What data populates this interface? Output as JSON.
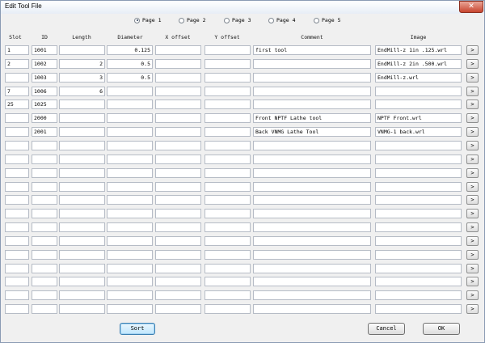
{
  "window": {
    "title": "Edit Tool File",
    "close_glyph": "✕"
  },
  "pages": [
    {
      "label": "Page 1",
      "selected": true
    },
    {
      "label": "Page 2",
      "selected": false
    },
    {
      "label": "Page 3",
      "selected": false
    },
    {
      "label": "Page 4",
      "selected": false
    },
    {
      "label": "Page 5",
      "selected": false
    }
  ],
  "columns": {
    "slot": "Slot",
    "id": "ID",
    "length": "Length",
    "diameter": "Diameter",
    "x_offset": "X offset",
    "y_offset": "Y offset",
    "comment": "Comment",
    "image": "Image"
  },
  "rows": [
    {
      "slot": "1",
      "id": "1001",
      "length": "",
      "diameter": "0.125",
      "x_offset": "",
      "y_offset": "",
      "comment": "first tool",
      "image": "EndMill-z 1in .125.wrl"
    },
    {
      "slot": "2",
      "id": "1002",
      "length": "2",
      "diameter": "0.5",
      "x_offset": "",
      "y_offset": "",
      "comment": "",
      "image": "EndMill-z 2in .500.wrl"
    },
    {
      "slot": "",
      "id": "1003",
      "length": "3",
      "diameter": "0.5",
      "x_offset": "",
      "y_offset": "",
      "comment": "",
      "image": "EndMill-z.wrl"
    },
    {
      "slot": "7",
      "id": "1006",
      "length": "6",
      "diameter": "",
      "x_offset": "",
      "y_offset": "",
      "comment": "",
      "image": ""
    },
    {
      "slot": "25",
      "id": "1025",
      "length": "",
      "diameter": "",
      "x_offset": "",
      "y_offset": "",
      "comment": "",
      "image": ""
    },
    {
      "slot": "",
      "id": "2000",
      "length": "",
      "diameter": "",
      "x_offset": "",
      "y_offset": "",
      "comment": "Front NPTF Lathe tool",
      "image": "NPTF Front.wrl"
    },
    {
      "slot": "",
      "id": "2001",
      "length": "",
      "diameter": "",
      "x_offset": "",
      "y_offset": "",
      "comment": "Back VNMG Lathe Tool",
      "image": "VNMG-1 back.wrl"
    },
    {
      "slot": "",
      "id": "",
      "length": "",
      "diameter": "",
      "x_offset": "",
      "y_offset": "",
      "comment": "",
      "image": ""
    },
    {
      "slot": "",
      "id": "",
      "length": "",
      "diameter": "",
      "x_offset": "",
      "y_offset": "",
      "comment": "",
      "image": ""
    },
    {
      "slot": "",
      "id": "",
      "length": "",
      "diameter": "",
      "x_offset": "",
      "y_offset": "",
      "comment": "",
      "image": ""
    },
    {
      "slot": "",
      "id": "",
      "length": "",
      "diameter": "",
      "x_offset": "",
      "y_offset": "",
      "comment": "",
      "image": ""
    },
    {
      "slot": "",
      "id": "",
      "length": "",
      "diameter": "",
      "x_offset": "",
      "y_offset": "",
      "comment": "",
      "image": ""
    },
    {
      "slot": "",
      "id": "",
      "length": "",
      "diameter": "",
      "x_offset": "",
      "y_offset": "",
      "comment": "",
      "image": ""
    },
    {
      "slot": "",
      "id": "",
      "length": "",
      "diameter": "",
      "x_offset": "",
      "y_offset": "",
      "comment": "",
      "image": ""
    },
    {
      "slot": "",
      "id": "",
      "length": "",
      "diameter": "",
      "x_offset": "",
      "y_offset": "",
      "comment": "",
      "image": ""
    },
    {
      "slot": "",
      "id": "",
      "length": "",
      "diameter": "",
      "x_offset": "",
      "y_offset": "",
      "comment": "",
      "image": ""
    },
    {
      "slot": "",
      "id": "",
      "length": "",
      "diameter": "",
      "x_offset": "",
      "y_offset": "",
      "comment": "",
      "image": ""
    },
    {
      "slot": "",
      "id": "",
      "length": "",
      "diameter": "",
      "x_offset": "",
      "y_offset": "",
      "comment": "",
      "image": ""
    },
    {
      "slot": "",
      "id": "",
      "length": "",
      "diameter": "",
      "x_offset": "",
      "y_offset": "",
      "comment": "",
      "image": ""
    },
    {
      "slot": "",
      "id": "",
      "length": "",
      "diameter": "",
      "x_offset": "",
      "y_offset": "",
      "comment": "",
      "image": ""
    }
  ],
  "browse_label": ">",
  "buttons": {
    "sort": "Sort",
    "cancel": "Cancel",
    "ok": "OK"
  }
}
